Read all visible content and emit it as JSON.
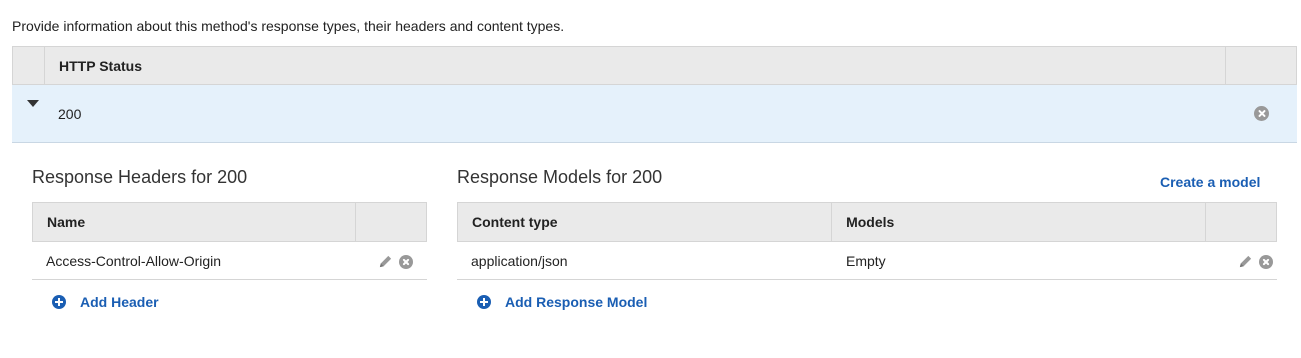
{
  "intro": "Provide information about this method's response types, their headers and content types.",
  "status_table": {
    "header": "HTTP Status",
    "row": {
      "code": "200"
    }
  },
  "headers_panel": {
    "title": "Response Headers for 200",
    "column_name": "Name",
    "rows": [
      {
        "name": "Access-Control-Allow-Origin"
      }
    ],
    "add_label": "Add Header"
  },
  "models_panel": {
    "title": "Response Models for 200",
    "create_label": "Create a model",
    "column_content_type": "Content type",
    "column_models": "Models",
    "rows": [
      {
        "content_type": "application/json",
        "model": "Empty"
      }
    ],
    "add_label": "Add Response Model"
  },
  "icons": {
    "expand": "caret-down-icon",
    "delete": "close-circle-icon",
    "edit": "pencil-icon",
    "add": "plus-circle-icon"
  },
  "colors": {
    "link": "#1a5eb3",
    "selected_row": "#e5f1fb",
    "table_header": "#eaeaea"
  }
}
